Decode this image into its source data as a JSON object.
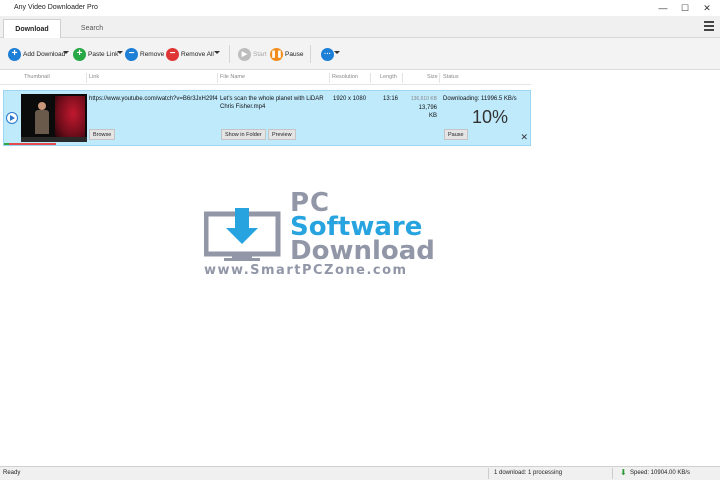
{
  "app": {
    "title": "Any Video Downloader Pro"
  },
  "window": {
    "minimize": "—",
    "maximize": "☐",
    "close": "✕"
  },
  "tabs": [
    {
      "label": "Download",
      "active": true
    },
    {
      "label": "Search",
      "active": false
    }
  ],
  "toolbar": {
    "add_download": "Add Download",
    "paste_link": "Paste Link",
    "remove": "Remove",
    "remove_all": "Remove All",
    "start": "Start",
    "pause": "Pause",
    "more": "···"
  },
  "columns": {
    "thumbnail": "Thumbnail",
    "link": "Link",
    "file_name": "File Name",
    "resolution": "Resolution",
    "length": "Length",
    "size": "Size",
    "status": "Status"
  },
  "download": {
    "link": "https://www.youtube.com/watch?v=B6r3JxH29f4",
    "file_name_line1": "Let's scan the whole planet with LiDAR",
    "file_name_line2": "Chris Fisher.mp4",
    "resolution": "1920 x 1080",
    "length": "13:16",
    "size_downloaded": "136,610 KB",
    "size_total": "13,796 KB",
    "status": "Downloading: 11996.5 KB/s",
    "percent": "10%",
    "progress": 0.1,
    "browse": "Browse",
    "show_in_folder": "Show in Folder",
    "preview": "Preview",
    "pause": "Pause",
    "close": "✕"
  },
  "watermark": {
    "line1": "PC",
    "line2": "Software",
    "line3": "Download",
    "url": "www.SmartPCZone.com"
  },
  "status": {
    "ready": "Ready",
    "downloads": "1 download: 1 processing",
    "speed": "Speed: 10904.00 KB/s"
  },
  "colors": {
    "add": "#1e7fd6",
    "paste": "#28a745",
    "remove": "#1e7fd6",
    "remove_all": "#e03535",
    "start": "#bdbdbd",
    "pause": "#f28c1a",
    "more": "#1e7fd6",
    "row_bg": "#bfeafc",
    "watermark_blue": "#27a4e0",
    "watermark_gray": "#9297a8"
  }
}
